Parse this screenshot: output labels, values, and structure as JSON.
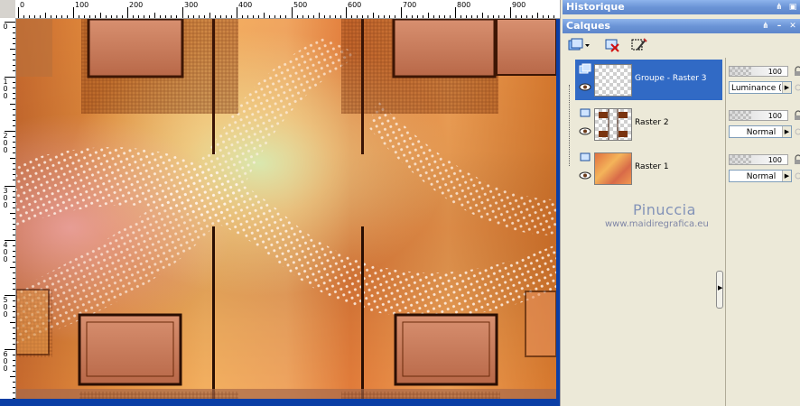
{
  "rulers": {
    "top_labels": [
      "0",
      "100",
      "200",
      "300",
      "400",
      "500",
      "600",
      "700",
      "800",
      "900"
    ],
    "left_labels": [
      [
        "0"
      ],
      [
        "1",
        "0",
        "0"
      ],
      [
        "2",
        "0",
        "0"
      ],
      [
        "3",
        "0",
        "0"
      ],
      [
        "4",
        "0",
        "0"
      ],
      [
        "5",
        "0",
        "0"
      ],
      [
        "6",
        "0",
        "0"
      ]
    ]
  },
  "history_palette": {
    "title": "Historique"
  },
  "layers_palette": {
    "title": "Calques",
    "layers": [
      {
        "name": "Groupe - Raster 3",
        "opacity": "100",
        "blend": "Luminance (H)",
        "selected": true,
        "type": "group"
      },
      {
        "name": "Raster 2",
        "opacity": "100",
        "blend": "Normal",
        "selected": false,
        "type": "raster"
      },
      {
        "name": "Raster 1",
        "opacity": "100",
        "blend": "Normal",
        "selected": false,
        "type": "raster"
      }
    ]
  },
  "watermark": {
    "name": "Pinuccia",
    "url": "www.maidiregrafica.eu"
  },
  "colors": {
    "title_bar": "#6b94d6",
    "selection": "#316ac5",
    "workspace": "#0b3ea5",
    "dock_bg": "#ece9d8"
  },
  "icons": [
    "layer-group-icon",
    "delete-layer-icon",
    "edit-selection-icon",
    "eye-icon",
    "lock-icon",
    "link-icon",
    "pin-icon",
    "restore-icon",
    "close-icon",
    "minimize-icon"
  ]
}
